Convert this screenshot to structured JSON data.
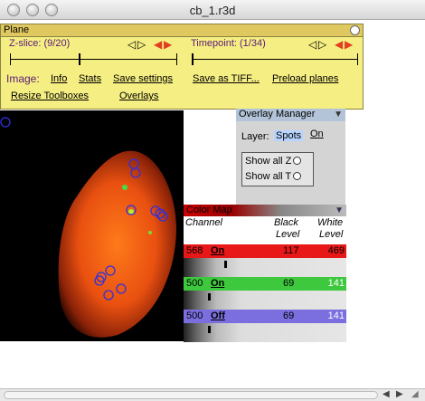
{
  "window": {
    "title": "cb_1.r3d"
  },
  "plane": {
    "title": "Plane",
    "zslice": "Z-slice: (9/20)",
    "timepoint": "Timepoint: (1/34)",
    "image_label": "Image:",
    "info": "Info",
    "stats": "Stats",
    "save_settings": "Save settings",
    "save_tiff": "Save as TIFF...",
    "preload": "Preload planes",
    "resize": "Resize Toolboxes",
    "overlays": "Overlays"
  },
  "overlay_manager": {
    "title": "Overlay Manager",
    "layer_label": "Layer:",
    "layer_value": "Spots",
    "on": "On",
    "show_all_z": "Show all Z",
    "show_all_t": "Show all T"
  },
  "color_map": {
    "title": "Color Map",
    "channel_hdr": "Channel",
    "black_hdr_1": "Black",
    "black_hdr_2": "Level",
    "white_hdr_1": "White",
    "white_hdr_2": "Level",
    "channels": [
      {
        "name": "568",
        "state": "On",
        "black": "117",
        "white": "469",
        "color": "#e81818",
        "level": 0.25
      },
      {
        "name": "500",
        "state": "On",
        "black": "69",
        "white": "141",
        "color": "#3ec83e",
        "level": 0.15
      },
      {
        "name": "500",
        "state": "Off",
        "black": "69",
        "white": "141",
        "color": "#7b6fe0",
        "level": 0.15
      }
    ]
  }
}
